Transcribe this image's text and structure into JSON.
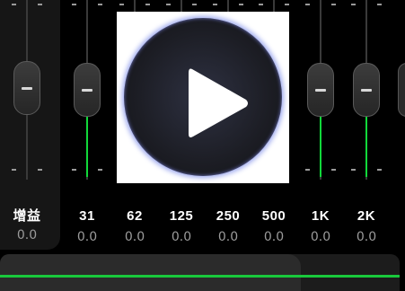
{
  "gain": {
    "label": "增益",
    "value": "0.0"
  },
  "bands": [
    {
      "label": "31",
      "value": "0.0",
      "fill": true
    },
    {
      "label": "62",
      "value": "0.0",
      "fill": false
    },
    {
      "label": "125",
      "value": "0.0",
      "fill": false
    },
    {
      "label": "250",
      "value": "0.0",
      "fill": false
    },
    {
      "label": "500",
      "value": "0.0",
      "fill": false
    },
    {
      "label": "1K",
      "value": "0.0",
      "fill": true
    },
    {
      "label": "2K",
      "value": "0.0",
      "fill": true
    }
  ],
  "colors": {
    "accent": "#11d93a",
    "background": "#000000",
    "panel": "#161616"
  },
  "overlay": {
    "icon": "play-icon"
  }
}
